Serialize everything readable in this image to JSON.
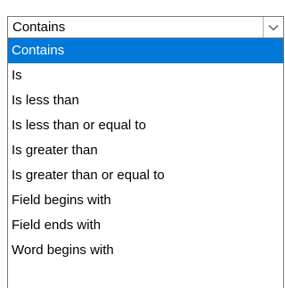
{
  "combo": {
    "selected_value": "Contains",
    "arrow_icon": "chevron-down-icon"
  },
  "colors": {
    "highlight": "#0078d7",
    "highlight_text": "#ffffff",
    "border": "#7a7a7a"
  },
  "options": [
    {
      "label": "Contains",
      "selected": true
    },
    {
      "label": "Is",
      "selected": false
    },
    {
      "label": "Is less than",
      "selected": false
    },
    {
      "label": "Is less than or equal to",
      "selected": false
    },
    {
      "label": "Is greater than",
      "selected": false
    },
    {
      "label": "Is greater than or equal to",
      "selected": false
    },
    {
      "label": "Field begins with",
      "selected": false
    },
    {
      "label": "Field ends with",
      "selected": false
    },
    {
      "label": "Word begins with",
      "selected": false
    }
  ]
}
